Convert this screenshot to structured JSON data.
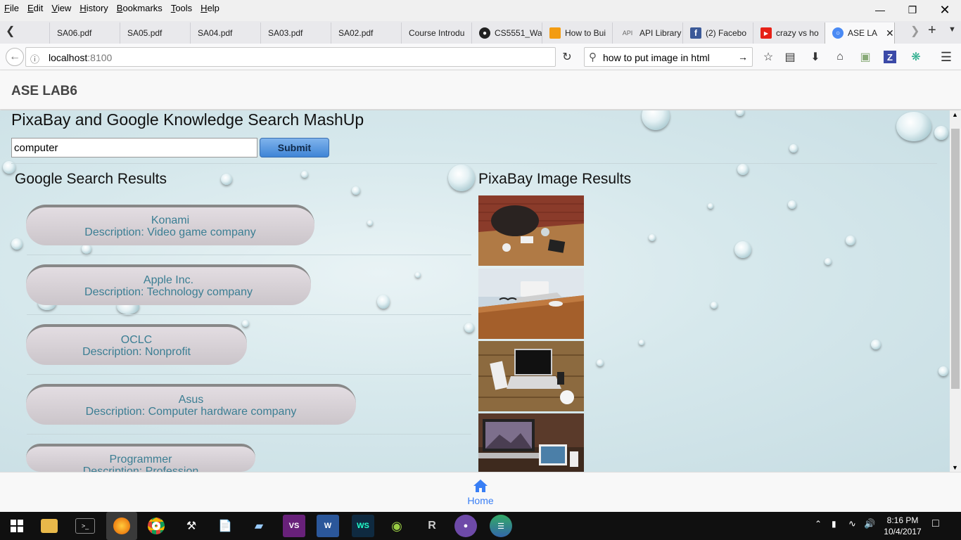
{
  "menubar": {
    "items": [
      "File",
      "Edit",
      "View",
      "History",
      "Bookmarks",
      "Tools",
      "Help"
    ]
  },
  "tabs": [
    {
      "label": "SA06.pdf",
      "icon": "pdf-icon"
    },
    {
      "label": "SA05.pdf",
      "icon": "pdf-icon"
    },
    {
      "label": "SA04.pdf",
      "icon": "pdf-icon"
    },
    {
      "label": "SA03.pdf",
      "icon": "pdf-icon"
    },
    {
      "label": "SA02.pdf",
      "icon": "pdf-icon"
    },
    {
      "label": "Course Introdu",
      "icon": "none"
    },
    {
      "label": "CS5551_Wa",
      "icon": "github-icon"
    },
    {
      "label": "How to Bui",
      "icon": "box-icon"
    },
    {
      "label": "API Library",
      "icon": "api-icon"
    },
    {
      "label": "(2) Facebo",
      "icon": "facebook-icon"
    },
    {
      "label": "crazy vs ho",
      "icon": "youtube-icon"
    },
    {
      "label": "ASE LA",
      "icon": "ionic-icon"
    }
  ],
  "url": {
    "host": "localhost",
    "port": ":8100"
  },
  "search": {
    "value": "how to put image in html"
  },
  "app": {
    "header_title": "ASE LAB6",
    "page_title": "PixaBay and Google Knowledge Search MashUp",
    "query": "computer",
    "submit_label": "Submit",
    "google_heading": "Google Search Results",
    "pixabay_heading": "PixaBay Image Results",
    "results": [
      {
        "name": "Konami",
        "description": "Description: Video game company"
      },
      {
        "name": "Apple Inc.",
        "description": "Description: Technology company"
      },
      {
        "name": "OCLC",
        "description": "Description: Nonprofit"
      },
      {
        "name": "Asus",
        "description": "Description: Computer hardware company"
      },
      {
        "name": "Programmer",
        "description": "Description: Profession"
      }
    ]
  },
  "bottom_tab": {
    "label": "Home",
    "icon": "home-icon",
    "color": "#387ef5"
  },
  "taskbar": {
    "time": "8:16 PM",
    "date": "10/4/2017"
  }
}
